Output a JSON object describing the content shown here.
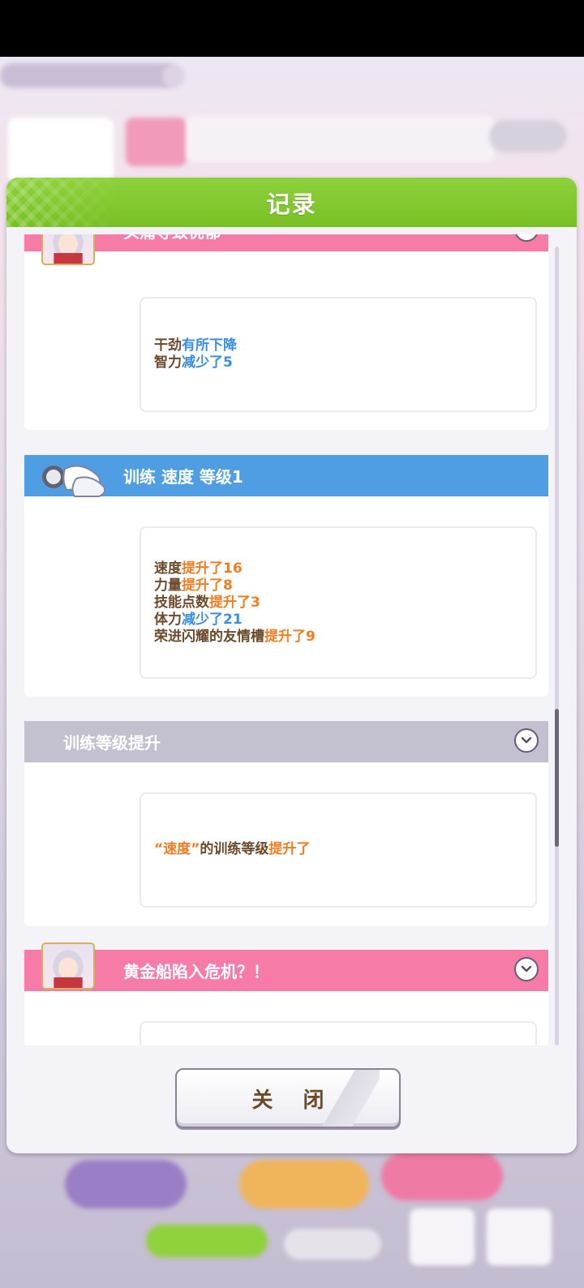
{
  "dialog": {
    "title": "记录",
    "close_label": "关 闭"
  },
  "records": [
    {
      "title": "头痛导致忧郁",
      "color": "#f77ba7",
      "icon": "character-portrait",
      "lines": [
        {
          "label": "干劲",
          "effect": "有所下降",
          "kind": "down"
        },
        {
          "label": "智力",
          "effect": "减少了5",
          "kind": "down"
        }
      ]
    },
    {
      "title": "训练  速度  等级1",
      "color": "#4f9ee3",
      "icon": "training-shoes-icon",
      "lines": [
        {
          "label": "速度",
          "effect": "提升了16",
          "kind": "up"
        },
        {
          "label": "力量",
          "effect": "提升了8",
          "kind": "up"
        },
        {
          "label": "技能点数",
          "effect": "提升了3",
          "kind": "up"
        },
        {
          "label": "体力",
          "effect": "减少了21",
          "kind": "down"
        },
        {
          "label": "荣进闪耀的友情槽",
          "effect": "提升了9",
          "kind": "up"
        }
      ]
    },
    {
      "title": "训练等级提升",
      "color": "#c3c0cf",
      "icon": "",
      "text": {
        "quote_open": "“",
        "name": "速度",
        "quote_close": "”",
        "middle": "的训练等级",
        "effect": "提升了"
      }
    },
    {
      "title": "黄金船陷入危机？！",
      "color": "#f77ba7",
      "icon": "character-portrait"
    }
  ],
  "colors": {
    "header_green": "#78c024",
    "up": "#ef7d22",
    "down": "#3a8fe0",
    "text": "#6b4a2a"
  }
}
